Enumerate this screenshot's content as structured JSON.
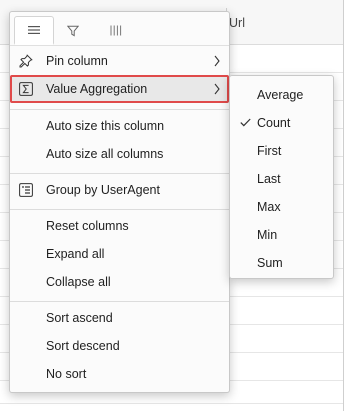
{
  "grid": {
    "column_header": "Url"
  },
  "menu": {
    "tabs": [
      {
        "icon": "menu-icon"
      },
      {
        "icon": "filter-icon"
      },
      {
        "icon": "columns-icon"
      }
    ],
    "pin_column": "Pin column",
    "value_aggregation": "Value Aggregation",
    "auto_size_this": "Auto size this column",
    "auto_size_all": "Auto size all columns",
    "group_by": "Group by UserAgent",
    "reset_columns": "Reset columns",
    "expand_all": "Expand all",
    "collapse_all": "Collapse all",
    "sort_ascend": "Sort ascend",
    "sort_descend": "Sort descend",
    "no_sort": "No sort"
  },
  "submenu": {
    "items": [
      {
        "label": "Average",
        "checked": false
      },
      {
        "label": "Count",
        "checked": true
      },
      {
        "label": "First",
        "checked": false
      },
      {
        "label": "Last",
        "checked": false
      },
      {
        "label": "Max",
        "checked": false
      },
      {
        "label": "Min",
        "checked": false
      },
      {
        "label": "Sum",
        "checked": false
      }
    ]
  },
  "colors": {
    "highlight_border": "#e04a4a",
    "highlight_bg": "#e8e8e8"
  }
}
